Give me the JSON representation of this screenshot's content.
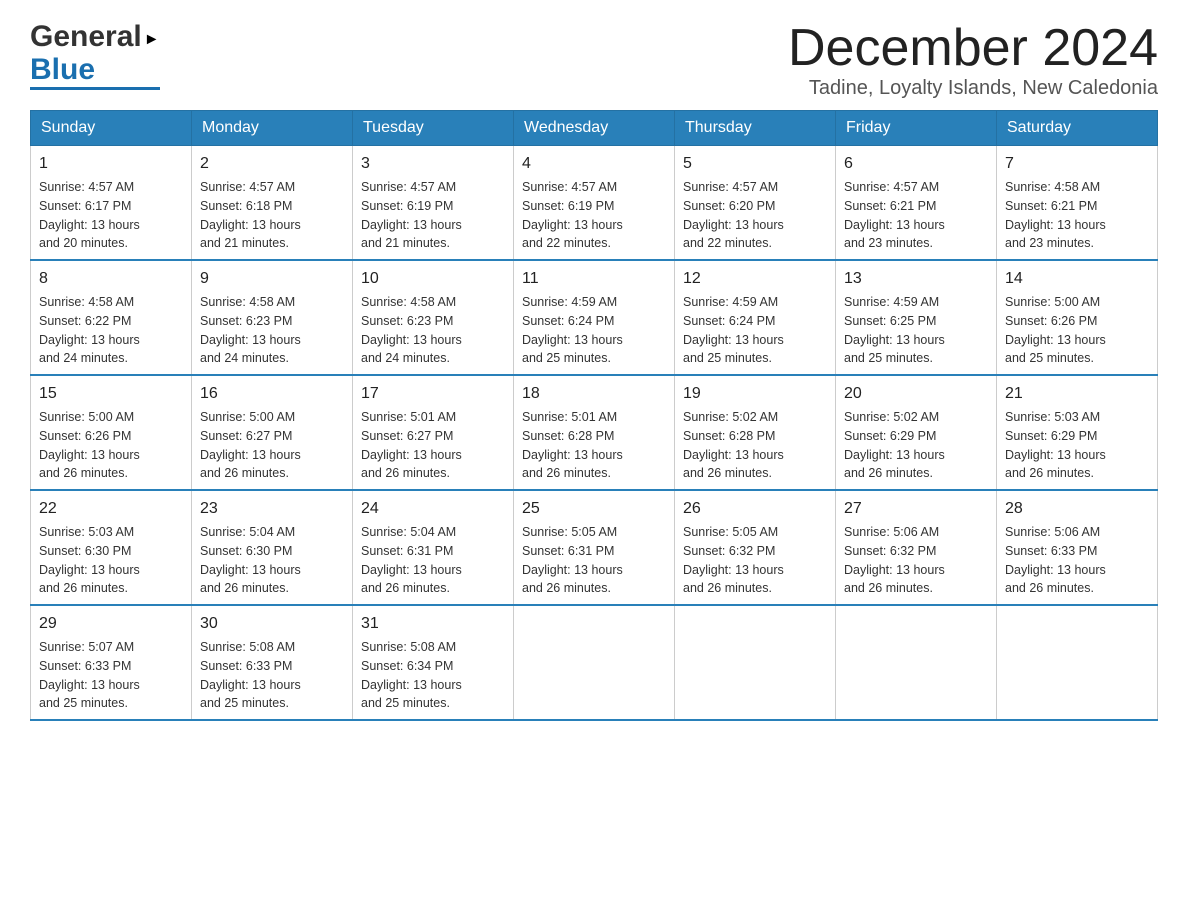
{
  "header": {
    "logo_general": "General",
    "logo_blue": "Blue",
    "month_title": "December 2024",
    "location": "Tadine, Loyalty Islands, New Caledonia"
  },
  "days_of_week": [
    "Sunday",
    "Monday",
    "Tuesday",
    "Wednesday",
    "Thursday",
    "Friday",
    "Saturday"
  ],
  "weeks": [
    [
      {
        "day": "1",
        "sunrise": "4:57 AM",
        "sunset": "6:17 PM",
        "daylight": "13 hours and 20 minutes."
      },
      {
        "day": "2",
        "sunrise": "4:57 AM",
        "sunset": "6:18 PM",
        "daylight": "13 hours and 21 minutes."
      },
      {
        "day": "3",
        "sunrise": "4:57 AM",
        "sunset": "6:19 PM",
        "daylight": "13 hours and 21 minutes."
      },
      {
        "day": "4",
        "sunrise": "4:57 AM",
        "sunset": "6:19 PM",
        "daylight": "13 hours and 22 minutes."
      },
      {
        "day": "5",
        "sunrise": "4:57 AM",
        "sunset": "6:20 PM",
        "daylight": "13 hours and 22 minutes."
      },
      {
        "day": "6",
        "sunrise": "4:57 AM",
        "sunset": "6:21 PM",
        "daylight": "13 hours and 23 minutes."
      },
      {
        "day": "7",
        "sunrise": "4:58 AM",
        "sunset": "6:21 PM",
        "daylight": "13 hours and 23 minutes."
      }
    ],
    [
      {
        "day": "8",
        "sunrise": "4:58 AM",
        "sunset": "6:22 PM",
        "daylight": "13 hours and 24 minutes."
      },
      {
        "day": "9",
        "sunrise": "4:58 AM",
        "sunset": "6:23 PM",
        "daylight": "13 hours and 24 minutes."
      },
      {
        "day": "10",
        "sunrise": "4:58 AM",
        "sunset": "6:23 PM",
        "daylight": "13 hours and 24 minutes."
      },
      {
        "day": "11",
        "sunrise": "4:59 AM",
        "sunset": "6:24 PM",
        "daylight": "13 hours and 25 minutes."
      },
      {
        "day": "12",
        "sunrise": "4:59 AM",
        "sunset": "6:24 PM",
        "daylight": "13 hours and 25 minutes."
      },
      {
        "day": "13",
        "sunrise": "4:59 AM",
        "sunset": "6:25 PM",
        "daylight": "13 hours and 25 minutes."
      },
      {
        "day": "14",
        "sunrise": "5:00 AM",
        "sunset": "6:26 PM",
        "daylight": "13 hours and 25 minutes."
      }
    ],
    [
      {
        "day": "15",
        "sunrise": "5:00 AM",
        "sunset": "6:26 PM",
        "daylight": "13 hours and 26 minutes."
      },
      {
        "day": "16",
        "sunrise": "5:00 AM",
        "sunset": "6:27 PM",
        "daylight": "13 hours and 26 minutes."
      },
      {
        "day": "17",
        "sunrise": "5:01 AM",
        "sunset": "6:27 PM",
        "daylight": "13 hours and 26 minutes."
      },
      {
        "day": "18",
        "sunrise": "5:01 AM",
        "sunset": "6:28 PM",
        "daylight": "13 hours and 26 minutes."
      },
      {
        "day": "19",
        "sunrise": "5:02 AM",
        "sunset": "6:28 PM",
        "daylight": "13 hours and 26 minutes."
      },
      {
        "day": "20",
        "sunrise": "5:02 AM",
        "sunset": "6:29 PM",
        "daylight": "13 hours and 26 minutes."
      },
      {
        "day": "21",
        "sunrise": "5:03 AM",
        "sunset": "6:29 PM",
        "daylight": "13 hours and 26 minutes."
      }
    ],
    [
      {
        "day": "22",
        "sunrise": "5:03 AM",
        "sunset": "6:30 PM",
        "daylight": "13 hours and 26 minutes."
      },
      {
        "day": "23",
        "sunrise": "5:04 AM",
        "sunset": "6:30 PM",
        "daylight": "13 hours and 26 minutes."
      },
      {
        "day": "24",
        "sunrise": "5:04 AM",
        "sunset": "6:31 PM",
        "daylight": "13 hours and 26 minutes."
      },
      {
        "day": "25",
        "sunrise": "5:05 AM",
        "sunset": "6:31 PM",
        "daylight": "13 hours and 26 minutes."
      },
      {
        "day": "26",
        "sunrise": "5:05 AM",
        "sunset": "6:32 PM",
        "daylight": "13 hours and 26 minutes."
      },
      {
        "day": "27",
        "sunrise": "5:06 AM",
        "sunset": "6:32 PM",
        "daylight": "13 hours and 26 minutes."
      },
      {
        "day": "28",
        "sunrise": "5:06 AM",
        "sunset": "6:33 PM",
        "daylight": "13 hours and 26 minutes."
      }
    ],
    [
      {
        "day": "29",
        "sunrise": "5:07 AM",
        "sunset": "6:33 PM",
        "daylight": "13 hours and 25 minutes."
      },
      {
        "day": "30",
        "sunrise": "5:08 AM",
        "sunset": "6:33 PM",
        "daylight": "13 hours and 25 minutes."
      },
      {
        "day": "31",
        "sunrise": "5:08 AM",
        "sunset": "6:34 PM",
        "daylight": "13 hours and 25 minutes."
      },
      null,
      null,
      null,
      null
    ]
  ],
  "labels": {
    "sunrise": "Sunrise:",
    "sunset": "Sunset:",
    "daylight": "Daylight:"
  }
}
